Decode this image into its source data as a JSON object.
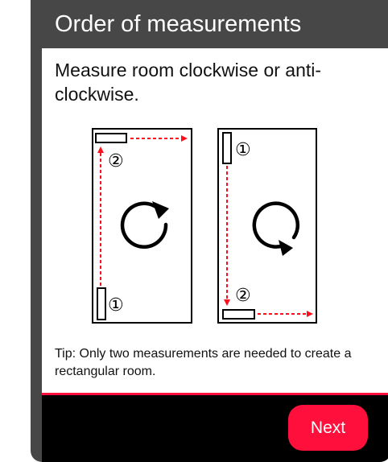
{
  "dialog": {
    "title": "Order of measurements",
    "heading": "Measure room clockwise or anti-clockwise.",
    "tip": "Tip: Only two measurements are needed to create a rectangular room.",
    "next_label": "Next"
  },
  "diagram_clockwise": {
    "first_marker": "①",
    "second_marker": "②",
    "rotation_icon": "clockwise-rotation-icon"
  },
  "diagram_anticlockwise": {
    "first_marker": "①",
    "second_marker": "②",
    "rotation_icon": "anticlockwise-rotation-icon"
  },
  "colors": {
    "title_bar": "#474747",
    "accent": "#ff0f3c",
    "arrow_dashed": "#ff0f1e",
    "footer": "#000000"
  }
}
